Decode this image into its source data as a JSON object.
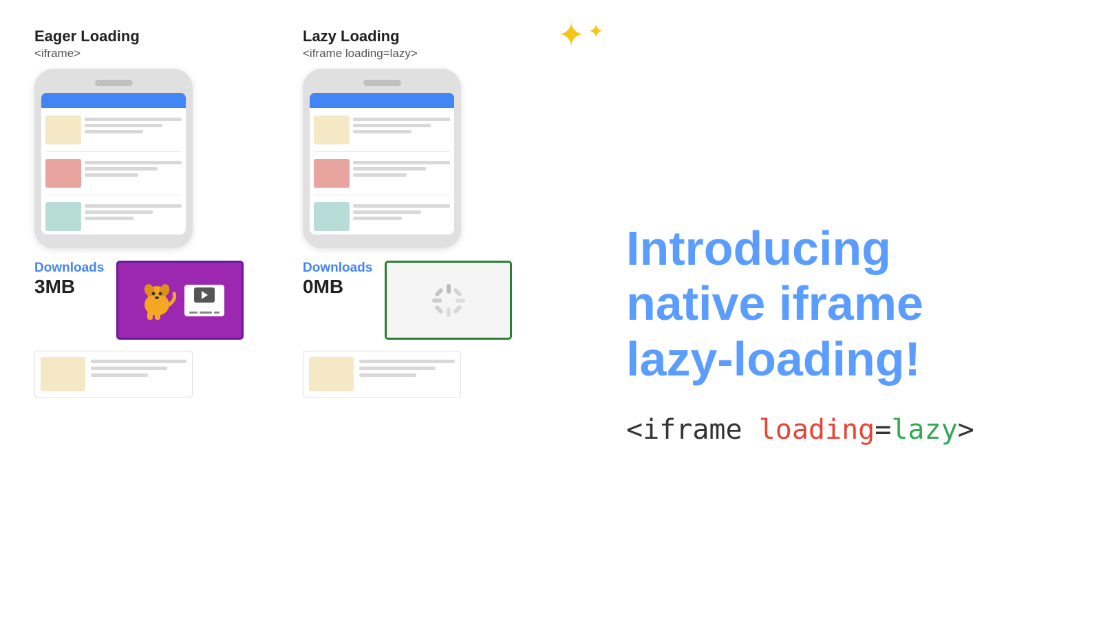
{
  "eager": {
    "title": "Eager Loading",
    "subtitle": "<iframe>",
    "downloads_label": "Downloads",
    "downloads_value": "3MB"
  },
  "lazy": {
    "title": "Lazy Loading",
    "subtitle": "<iframe loading=lazy>",
    "downloads_label": "Downloads",
    "downloads_value": "0MB"
  },
  "hero": {
    "introducing": "Introducing\nnative iframe\nlazy-loading!",
    "code": "<iframe loading=lazy>"
  },
  "cards": {
    "eager_card_lines_1": "",
    "eager_card_lines_2": "",
    "eager_card_lines_3": ""
  }
}
